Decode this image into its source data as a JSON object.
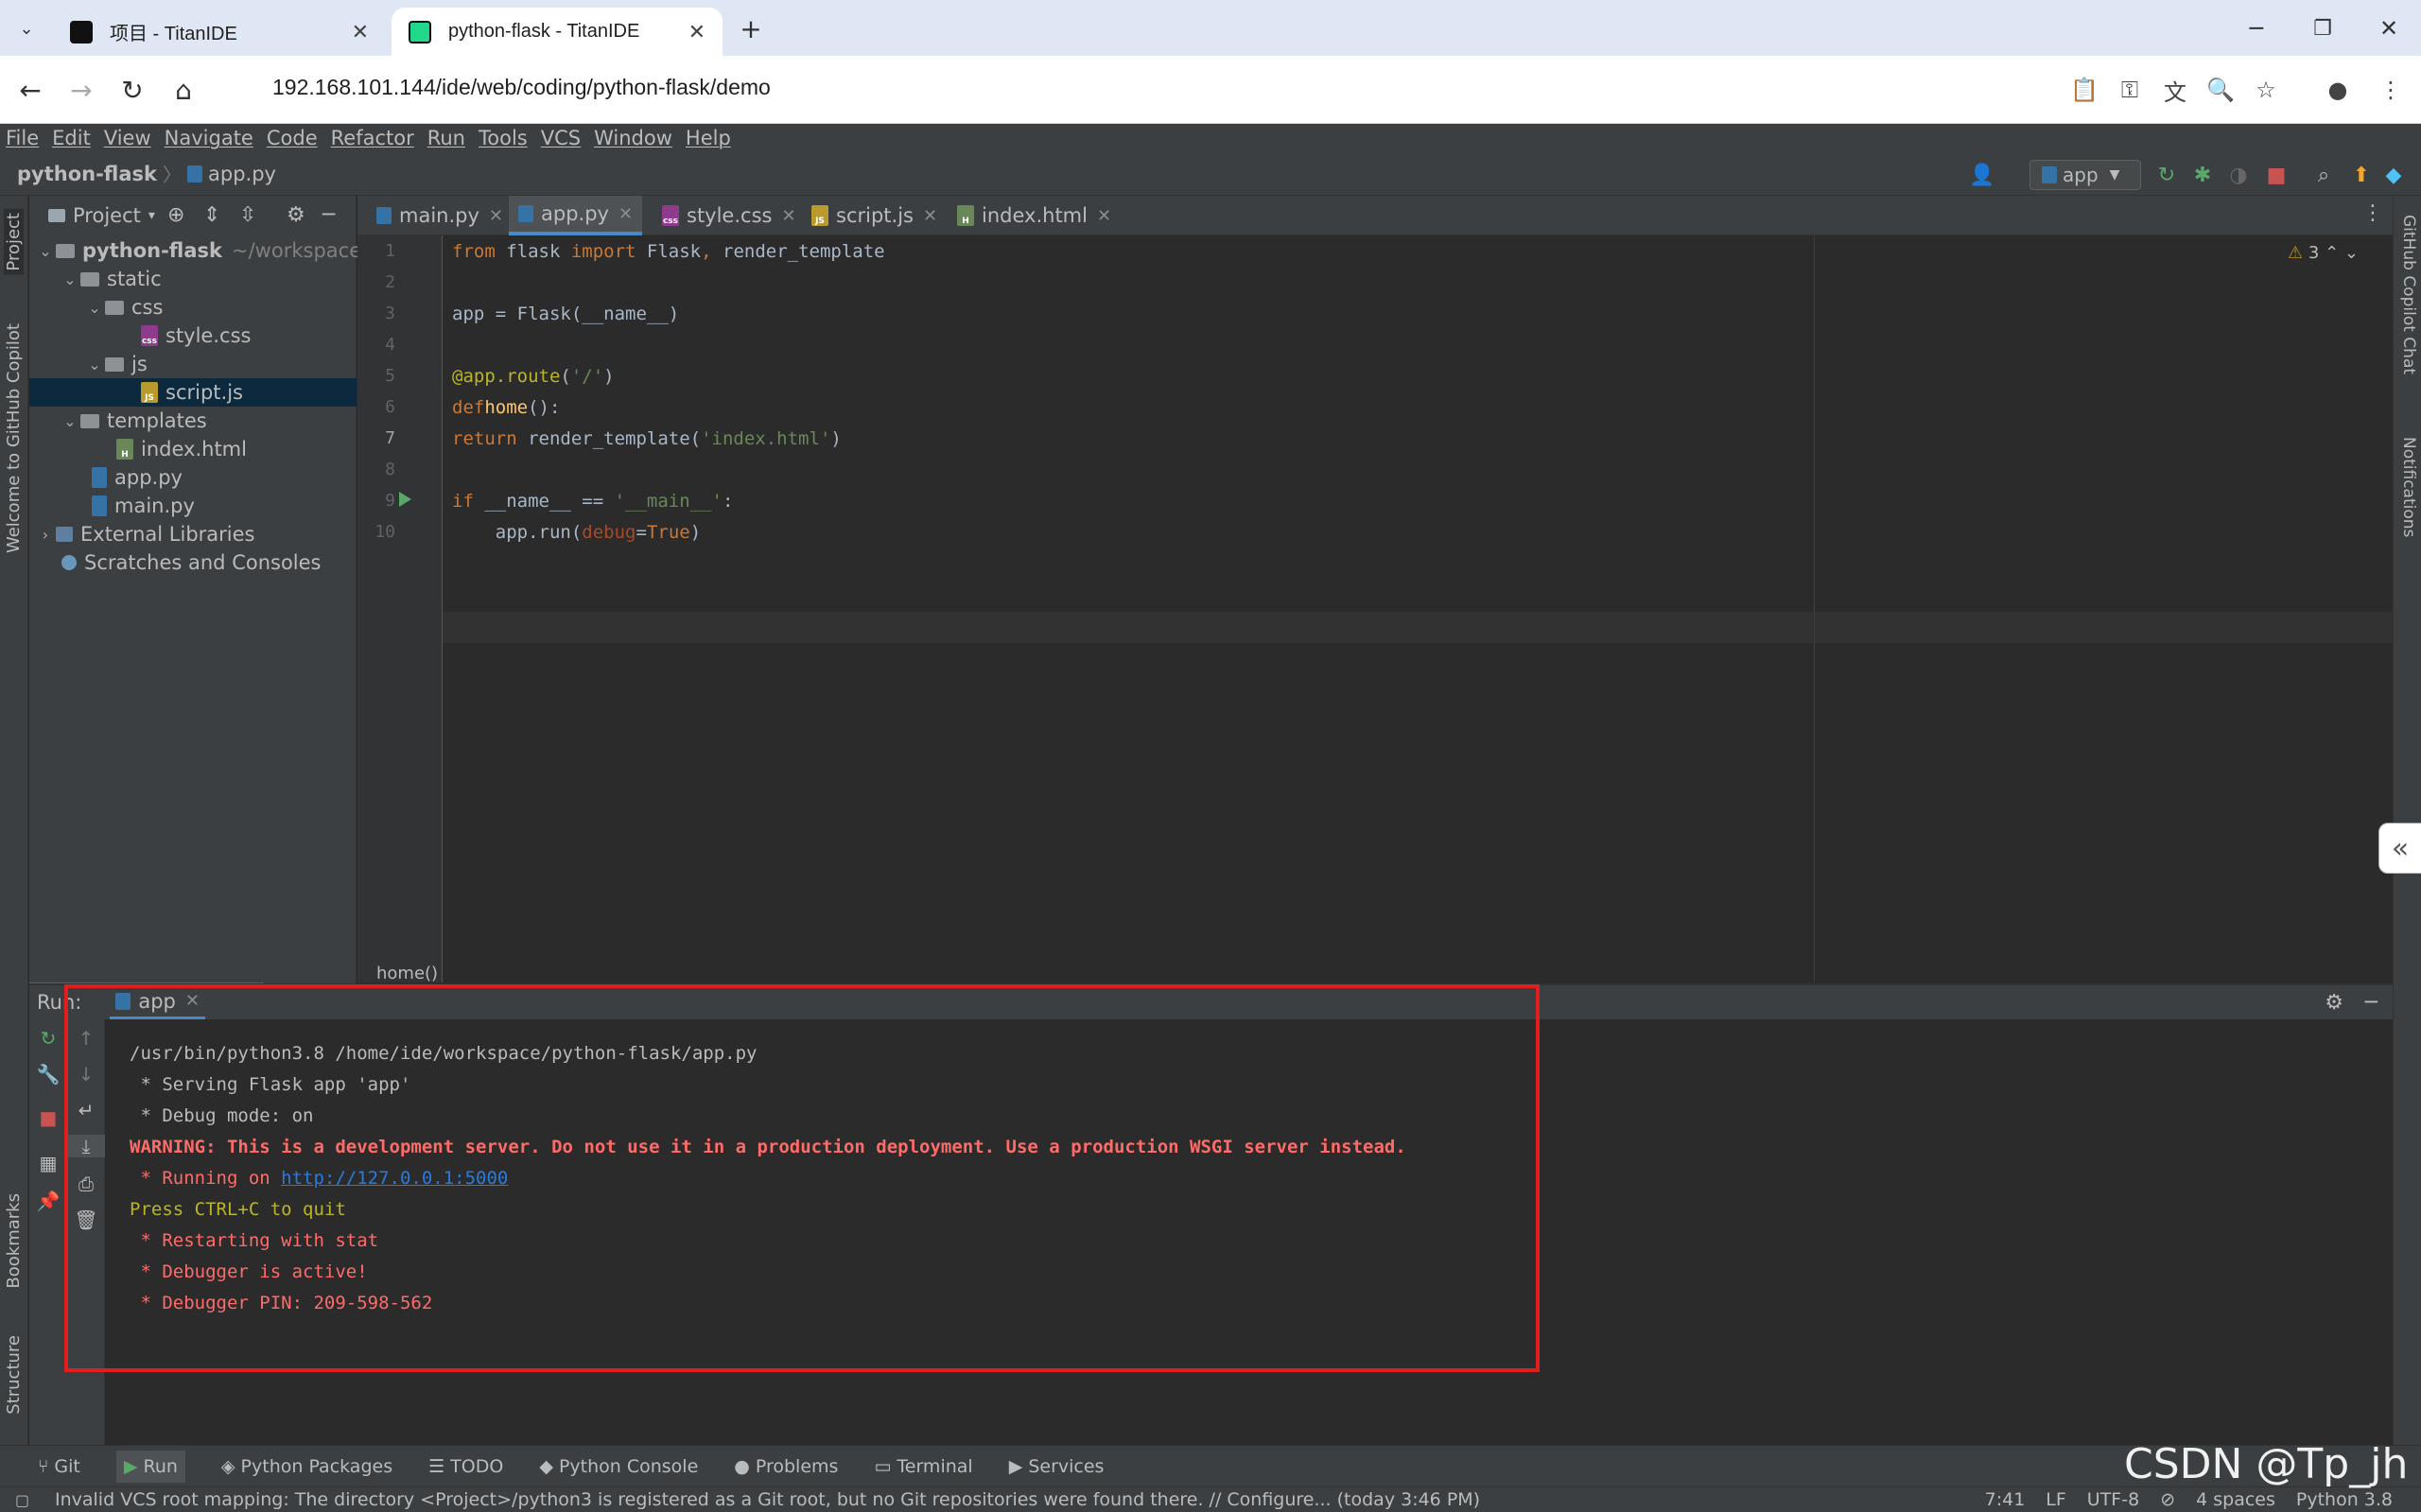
{
  "browser": {
    "tabs": [
      {
        "title": "项目 - TitanIDE",
        "active": false
      },
      {
        "title": "python-flask - TitanIDE",
        "active": true
      }
    ],
    "url": "192.168.101.144/ide/web/coding/python-flask/demo"
  },
  "menu": [
    "File",
    "Edit",
    "View",
    "Navigate",
    "Code",
    "Refactor",
    "Run",
    "Tools",
    "VCS",
    "Window",
    "Help"
  ],
  "navbar": {
    "project": "python-flask",
    "file": "app.py",
    "run_config": "app"
  },
  "left_strip": {
    "project": "Project",
    "copilot": "Welcome to GitHub Copilot",
    "bookmarks": "Bookmarks",
    "structure": "Structure"
  },
  "right_strip": {
    "copilot_chat": "GitHub Copilot Chat",
    "notifications": "Notifications"
  },
  "project_panel": {
    "title": "Project",
    "tree": [
      {
        "label": "python-flask",
        "extra": "~/workspace",
        "type": "folder"
      },
      {
        "label": "static",
        "type": "folder"
      },
      {
        "label": "css",
        "type": "folder"
      },
      {
        "label": "style.css",
        "type": "css"
      },
      {
        "label": "js",
        "type": "folder"
      },
      {
        "label": "script.js",
        "type": "js"
      },
      {
        "label": "templates",
        "type": "folder"
      },
      {
        "label": "index.html",
        "type": "html"
      },
      {
        "label": "app.py",
        "type": "py"
      },
      {
        "label": "main.py",
        "type": "py"
      },
      {
        "label": "External Libraries",
        "type": "lib"
      },
      {
        "label": "Scratches and Consoles",
        "type": "scratch"
      }
    ]
  },
  "editor": {
    "tabs": [
      "main.py",
      "app.py",
      "style.css",
      "script.js",
      "index.html"
    ],
    "active_tab": "app.py",
    "warnings": "3",
    "line_numbers": [
      "1",
      "2",
      "3",
      "4",
      "5",
      "6",
      "7",
      "8",
      "9",
      "10"
    ],
    "breadcrumb": "home()"
  },
  "run_panel": {
    "label": "Run:",
    "tab": "app",
    "console": [
      "/usr/bin/python3.8 /home/ide/workspace/python-flask/app.py",
      " * Serving Flask app 'app'",
      " * Debug mode: on",
      "WARNING: This is a development server. Do not use it in a production deployment. Use a production WSGI server instead.",
      " * Running on ",
      "http://127.0.0.1:5000",
      "Press CTRL+C to quit",
      " * Restarting with stat",
      " * Debugger is active!",
      " * Debugger PIN: 209-598-562"
    ]
  },
  "bottom_tabs": [
    "Git",
    "Run",
    "Python Packages",
    "TODO",
    "Python Console",
    "Problems",
    "Terminal",
    "Services"
  ],
  "status": {
    "message": "Invalid VCS root mapping: The directory <Project>/python3 is registered as a Git root, but no Git repositories were found there. // Configure... (today 3:46 PM)",
    "position": "7:41",
    "line_sep": "LF",
    "encoding": "UTF-8",
    "indent": "4 spaces",
    "interpreter": "Python 3.8"
  },
  "watermark": "CSDN @Tp_jh",
  "colors": {
    "accent": "#4a88c7",
    "highlight_box": "#e11d1d",
    "error_text": "#ff6b68"
  }
}
